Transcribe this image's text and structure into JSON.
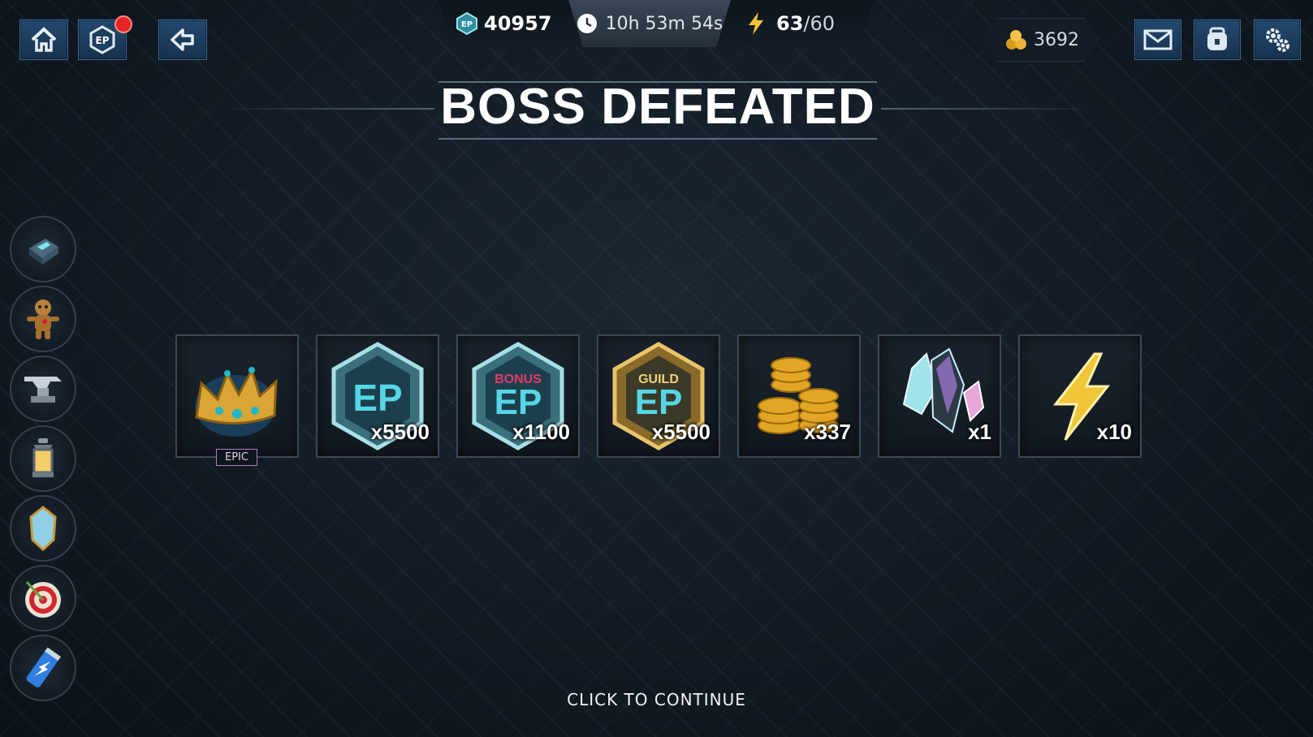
{
  "header": {
    "ep_icon_text": "EP",
    "ep_amount": "40957",
    "timer": "10h 53m 54s",
    "energy_current": "63",
    "energy_max": "/60",
    "gold": "3692"
  },
  "nav": {
    "ep_button_text": "EP"
  },
  "title": "BOSS DEFEATED",
  "rewards": [
    {
      "name": "crown",
      "rarity": "EPIC",
      "qty": ""
    },
    {
      "name": "ep",
      "badge": "EP",
      "qty": "x5500"
    },
    {
      "name": "bonus-ep",
      "badge": "EP",
      "sub": "BONUS",
      "qty": "x1100"
    },
    {
      "name": "guild-ep",
      "badge": "EP",
      "sub": "GUILD",
      "qty": "x5500"
    },
    {
      "name": "gold",
      "qty": "x337"
    },
    {
      "name": "crystal",
      "qty": "x1"
    },
    {
      "name": "energy",
      "qty": "x10"
    }
  ],
  "continue": "CLICK TO CONTINUE",
  "colors": {
    "accent": "#3fb6c8",
    "gold": "#e0a526",
    "bonus": "#e63a6a",
    "epic": "#b77bc4"
  }
}
